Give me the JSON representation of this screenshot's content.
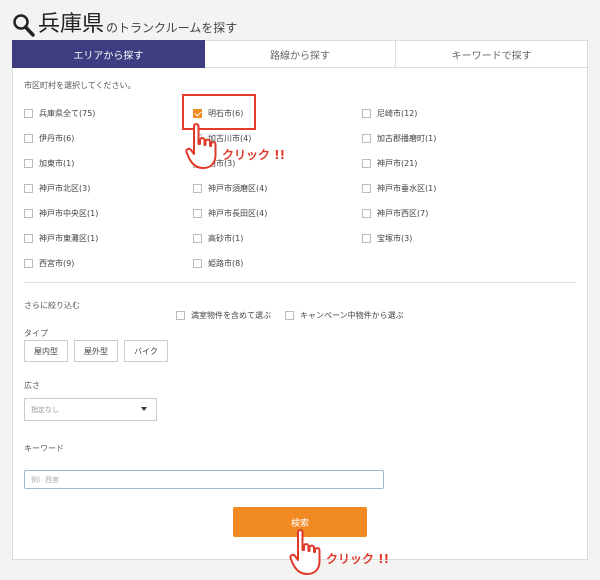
{
  "header": {
    "prefecture": "兵庫県",
    "subtitle": "のトランクルームを探す"
  },
  "tabs": [
    {
      "label": "エリアから探す",
      "active": true
    },
    {
      "label": "路線から探す",
      "active": false
    },
    {
      "label": "キーワードで探す",
      "active": false
    }
  ],
  "area": {
    "hint": "市区町村を選択してください。",
    "cities": [
      {
        "label": "兵庫県全て(75)",
        "checked": false
      },
      {
        "label": "明石市(6)",
        "checked": true
      },
      {
        "label": "尼崎市(12)",
        "checked": false
      },
      {
        "label": "伊丹市(6)",
        "checked": false
      },
      {
        "label": "加古川市(4)",
        "checked": false
      },
      {
        "label": "加古郡播磨町(1)",
        "checked": false
      },
      {
        "label": "加東市(1)",
        "checked": false
      },
      {
        "label": "西市(3)",
        "checked": false
      },
      {
        "label": "神戸市(21)",
        "checked": false
      },
      {
        "label": "神戸市北区(3)",
        "checked": false
      },
      {
        "label": "神戸市須磨区(4)",
        "checked": false
      },
      {
        "label": "神戸市垂水区(1)",
        "checked": false
      },
      {
        "label": "神戸市中央区(1)",
        "checked": false
      },
      {
        "label": "神戸市長田区(4)",
        "checked": false
      },
      {
        "label": "神戸市西区(7)",
        "checked": false
      },
      {
        "label": "神戸市東灘区(1)",
        "checked": false
      },
      {
        "label": "高砂市(1)",
        "checked": false
      },
      {
        "label": "宝塚市(3)",
        "checked": false
      },
      {
        "label": "西宮市(9)",
        "checked": false
      },
      {
        "label": "姫路市(8)",
        "checked": false
      }
    ]
  },
  "annotations": {
    "click1": "クリック !!",
    "click2": "クリック !!"
  },
  "refine": {
    "title": "さらに絞り込む",
    "options": [
      {
        "label": "満室物件を含めて選ぶ",
        "checked": false
      },
      {
        "label": "キャンペーン中物件から選ぶ",
        "checked": false
      }
    ],
    "type_label": "タイプ",
    "types": [
      "屋内型",
      "屋外型",
      "バイク"
    ],
    "size_label": "広さ",
    "size_selected": "指定なし",
    "keyword_label": "キーワード",
    "keyword_placeholder": "例）西宮"
  },
  "search_button": "検索",
  "colors": {
    "accent": "#3f3d81",
    "button": "#f28a24",
    "highlight": "#e43c2c"
  }
}
